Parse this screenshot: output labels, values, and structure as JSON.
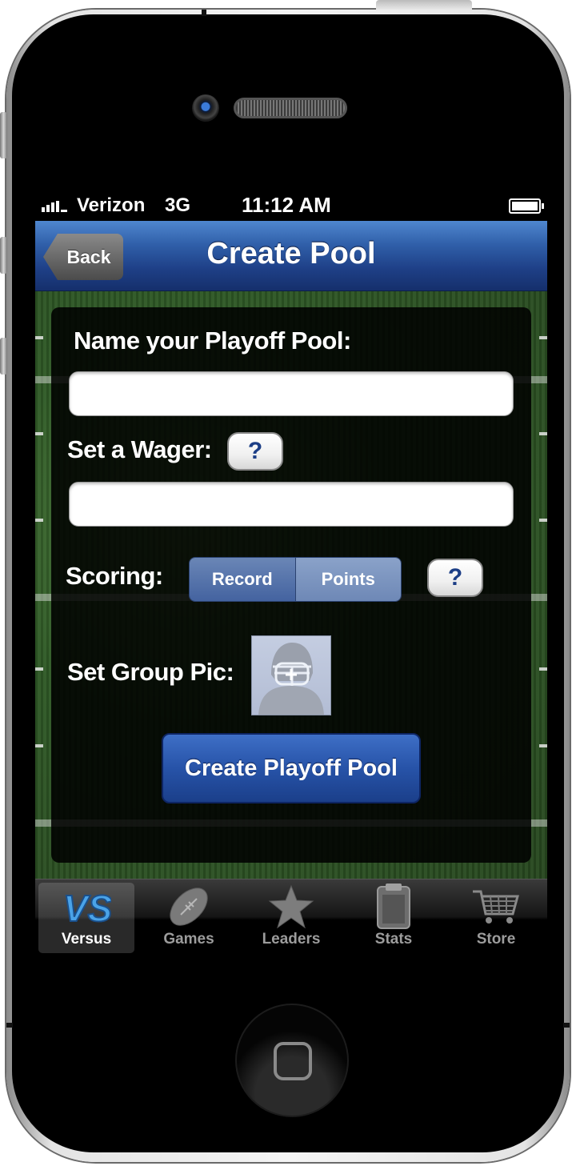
{
  "status_bar": {
    "carrier": "Verizon",
    "network": "3G",
    "time": "11:12 AM",
    "battery_level": 1.0
  },
  "nav": {
    "back_label": "Back",
    "title": "Create Pool"
  },
  "form": {
    "pool_name_label": "Name your Playoff Pool:",
    "pool_name_value": "",
    "wager_label": "Set a Wager:",
    "wager_value": "",
    "help_label": "?",
    "scoring_label": "Scoring:",
    "scoring_options": [
      "Record",
      "Points"
    ],
    "scoring_selected": "Record",
    "group_pic_label": "Set Group Pic:",
    "group_pic_icon": "football-helmet-add-icon",
    "submit_label": "Create Playoff Pool"
  },
  "tabs": [
    {
      "label": "Versus",
      "icon": "vs-icon",
      "active": true
    },
    {
      "label": "Games",
      "icon": "football-icon",
      "active": false
    },
    {
      "label": "Leaders",
      "icon": "star-icon",
      "active": false
    },
    {
      "label": "Stats",
      "icon": "clipboard-icon",
      "active": false
    },
    {
      "label": "Store",
      "icon": "shopping-cart-icon",
      "active": false
    }
  ],
  "colors": {
    "nav_blue": "#2f5ea8",
    "button_blue": "#2753a8",
    "help_text": "#1c3e86",
    "vs_blue": "#4aa3e8"
  }
}
